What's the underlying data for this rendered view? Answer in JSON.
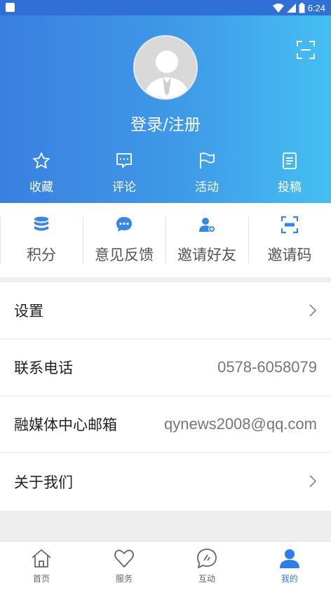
{
  "status_bar": {
    "time": "6:24"
  },
  "header": {
    "login_text": "登录/注册",
    "quick_actions": [
      {
        "label": "收藏",
        "icon": "star-icon"
      },
      {
        "label": "评论",
        "icon": "comment-icon"
      },
      {
        "label": "活动",
        "icon": "flag-icon"
      },
      {
        "label": "投稿",
        "icon": "document-icon"
      }
    ]
  },
  "features": [
    {
      "label": "积分",
      "icon": "database-icon"
    },
    {
      "label": "意见反馈",
      "icon": "chat-bubble-icon"
    },
    {
      "label": "邀请好友",
      "icon": "add-user-icon"
    },
    {
      "label": "邀请码",
      "icon": "code-box-icon"
    }
  ],
  "settings_list": [
    {
      "label": "设置",
      "value": ""
    },
    {
      "label": "联系电话",
      "value": "0578-6058079"
    },
    {
      "label": "融媒体中心邮箱",
      "value": "qynews2008@qq.com"
    },
    {
      "label": "关于我们",
      "value": ""
    }
  ],
  "tabbar": {
    "tabs": [
      {
        "label": "首页"
      },
      {
        "label": "服务"
      },
      {
        "label": "互动"
      },
      {
        "label": "我的"
      }
    ],
    "active_index": 3
  },
  "colors": {
    "accent": "#2e7de8",
    "header_start": "#3a7fe0",
    "header_end": "#45bff2"
  }
}
